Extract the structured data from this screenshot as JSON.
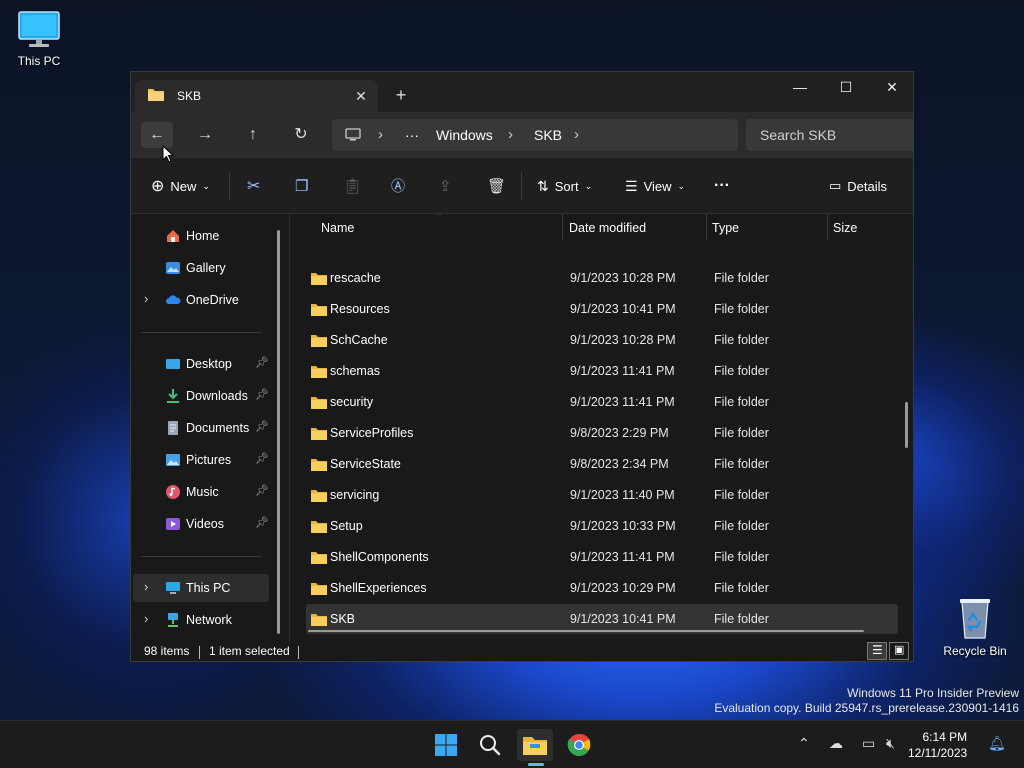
{
  "desktop": {
    "icons": [
      {
        "label": "This PC"
      },
      {
        "label": "Recycle Bin"
      }
    ],
    "watermark": {
      "line1": "Windows 11 Pro Insider Preview",
      "line2": "Evaluation copy. Build 25947.rs_prerelease.230901-1416"
    }
  },
  "window": {
    "tab_title": "SKB",
    "tab_close": "✕",
    "new_tab": "+",
    "minimize": "—",
    "maximize": "☐",
    "close": "✕"
  },
  "navigation": {
    "back": "←",
    "forward": "→",
    "up": "↑",
    "refresh": "↻",
    "breadcrumbs": [
      "Windows",
      "SKB"
    ],
    "ellipsis": "···",
    "search_placeholder": "Search SKB"
  },
  "toolbar": {
    "new_label": "New",
    "sort_label": "Sort",
    "view_label": "View",
    "more_label": "···",
    "details_label": "Details"
  },
  "sidebar": {
    "items": [
      {
        "label": "Home",
        "icon": "home-icon"
      },
      {
        "label": "Gallery",
        "icon": "gallery-icon"
      },
      {
        "label": "OneDrive",
        "icon": "onedrive-icon",
        "expandable": true
      },
      {
        "label": "Desktop",
        "icon": "desktop-icon",
        "pinned": true
      },
      {
        "label": "Downloads",
        "icon": "downloads-icon",
        "pinned": true
      },
      {
        "label": "Documents",
        "icon": "documents-icon",
        "pinned": true
      },
      {
        "label": "Pictures",
        "icon": "pictures-icon",
        "pinned": true
      },
      {
        "label": "Music",
        "icon": "music-icon",
        "pinned": true
      },
      {
        "label": "Videos",
        "icon": "videos-icon",
        "pinned": true
      },
      {
        "label": "This PC",
        "icon": "this-pc-icon",
        "expandable": true,
        "selected": true
      },
      {
        "label": "Network",
        "icon": "network-icon",
        "expandable": true
      }
    ]
  },
  "columns": {
    "name": "Name",
    "date": "Date modified",
    "type": "Type",
    "size": "Size"
  },
  "files": [
    {
      "name": "rescache",
      "date": "9/1/2023 10:28 PM",
      "type": "File folder"
    },
    {
      "name": "Resources",
      "date": "9/1/2023 10:41 PM",
      "type": "File folder"
    },
    {
      "name": "SchCache",
      "date": "9/1/2023 10:28 PM",
      "type": "File folder"
    },
    {
      "name": "schemas",
      "date": "9/1/2023 11:41 PM",
      "type": "File folder"
    },
    {
      "name": "security",
      "date": "9/1/2023 11:41 PM",
      "type": "File folder"
    },
    {
      "name": "ServiceProfiles",
      "date": "9/8/2023 2:29 PM",
      "type": "File folder"
    },
    {
      "name": "ServiceState",
      "date": "9/8/2023 2:34 PM",
      "type": "File folder"
    },
    {
      "name": "servicing",
      "date": "9/1/2023 11:40 PM",
      "type": "File folder"
    },
    {
      "name": "Setup",
      "date": "9/1/2023 10:33 PM",
      "type": "File folder"
    },
    {
      "name": "ShellComponents",
      "date": "9/1/2023 11:41 PM",
      "type": "File folder"
    },
    {
      "name": "ShellExperiences",
      "date": "9/1/2023 10:29 PM",
      "type": "File folder"
    },
    {
      "name": "SKB",
      "date": "9/1/2023 10:41 PM",
      "type": "File folder",
      "selected": true
    }
  ],
  "status": {
    "item_count": "98 items",
    "selection": "1 item selected"
  },
  "taskbar": {
    "time": "6:14 PM",
    "date": "12/11/2023"
  },
  "colors": {
    "accent": "#6cb3ff",
    "folder": "#f2c55c",
    "background": "#191919"
  }
}
